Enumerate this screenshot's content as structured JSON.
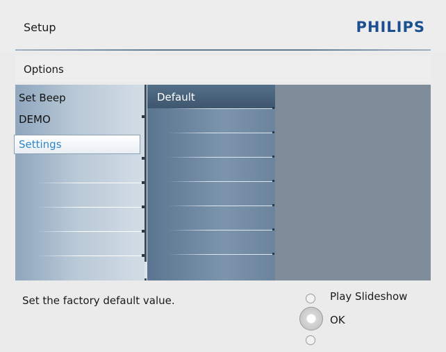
{
  "header": {
    "title": "Setup",
    "brand": "PHILIPS"
  },
  "options_bar": {
    "label": "Options"
  },
  "menu": {
    "items": [
      {
        "label": "Set Beep",
        "selected": false
      },
      {
        "label": "DEMO",
        "selected": false
      },
      {
        "label": "Settings",
        "selected": true
      }
    ]
  },
  "submenu": {
    "items": [
      {
        "label": "Default"
      }
    ]
  },
  "footer": {
    "hint": "Set the factory default value.",
    "controls": {
      "up_label": "Play Slideshow",
      "ok_label": "OK"
    }
  },
  "colors": {
    "brand": "#1c4f8f",
    "selected_text": "#2d86c7"
  }
}
